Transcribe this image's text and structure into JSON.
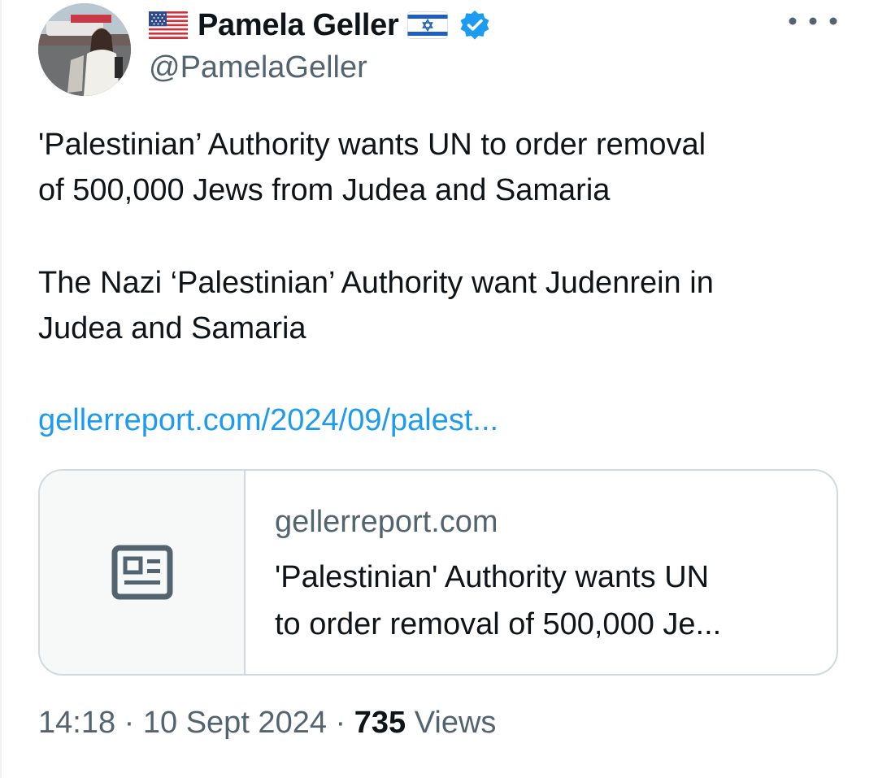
{
  "author": {
    "flag_before": "🇺🇸",
    "display_name": "Pamela Geller",
    "flag_after": "🇮🇱",
    "handle": "@PamelaGeller",
    "verified": true,
    "avatar_icon": "profile-photo"
  },
  "menu": {
    "icon": "more-options-icon"
  },
  "tweet": {
    "line1": "'Palestinian’ Authority wants UN to order removal",
    "line2": "of 500,000 Jews from Judea and Samaria",
    "line3": "The Nazi ‘Palestinian’ Authority want Judenrein in",
    "line4": "Judea and Samaria",
    "link": "gellerreport.com/2024/09/palest..."
  },
  "card": {
    "icon": "news-article-icon",
    "domain": "gellerreport.com",
    "title_line1": "'Palestinian' Authority wants UN",
    "title_line2": "to order removal of 500,000 Je..."
  },
  "meta": {
    "time": "14:18",
    "separator": " · ",
    "date": "10 Sept 2024",
    "views_count": "735",
    "views_label": "Views"
  },
  "colors": {
    "text_primary": "#0f1419",
    "text_secondary": "#536471",
    "link": "#1d9bf0",
    "verified": "#1d9bf0",
    "border": "#cfd9de"
  }
}
